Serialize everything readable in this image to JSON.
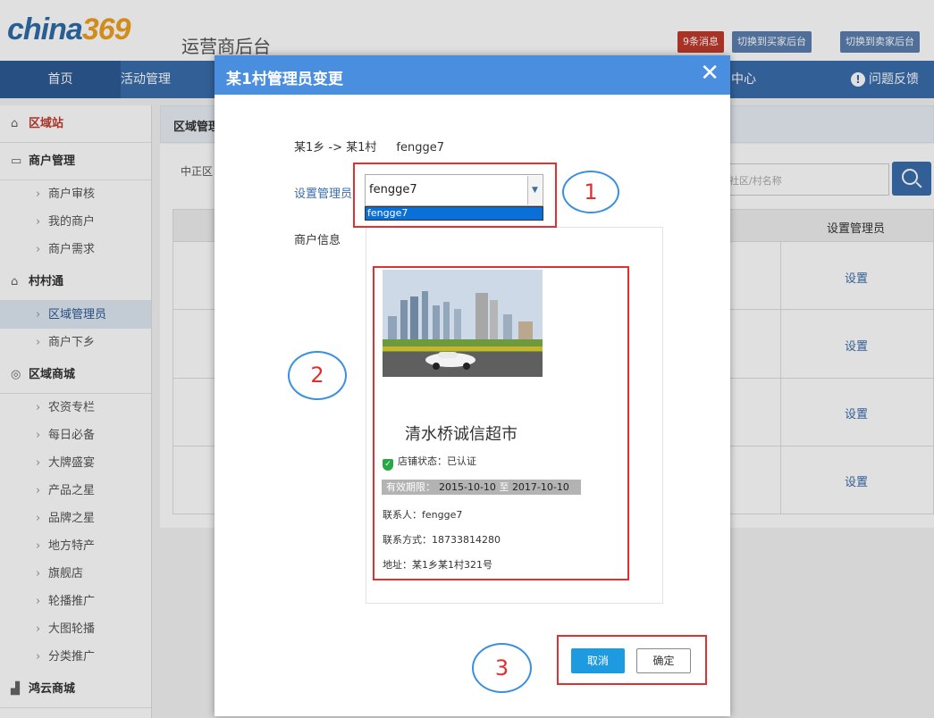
{
  "header": {
    "logo_main": "china",
    "logo_num": "369",
    "system_title": "运营商后台",
    "messages": "9条消息",
    "switch_buyer": "切换到买家后台",
    "switch_seller": "切换到卖家后台"
  },
  "nav": {
    "home": "首页",
    "activity": "活动管理",
    "center": "中心",
    "feedback": "问题反馈"
  },
  "sidebar": {
    "groups": [
      {
        "label": "区域站",
        "icon": "home-icon"
      },
      {
        "label": "商户管理",
        "icon": "shop-icon",
        "items": [
          "商户审核",
          "我的商户",
          "商户需求"
        ]
      },
      {
        "label": "村村通",
        "icon": "home-icon",
        "items": [
          "区域管理员",
          "商户下乡"
        ]
      },
      {
        "label": "区域商城",
        "icon": "mall-icon",
        "items": [
          "农资专栏",
          "每日必备",
          "大牌盛宴",
          "产品之星",
          "品牌之星",
          "地方特产",
          "旗舰店",
          "轮播推广",
          "大图轮播",
          "分类推广"
        ]
      },
      {
        "label": "鸿云商城",
        "icon": "chart-icon"
      }
    ]
  },
  "main": {
    "section_title": "区域管理",
    "filter_left": "中正区",
    "search_placeholder": "社区/村名称",
    "col_admin": "设置管理员",
    "set_link": "设置"
  },
  "modal": {
    "title": "某1村管理员变更",
    "path": "某1乡 -> 某1村",
    "current_admin": "fengge7",
    "label_set_admin": "设置管理员",
    "select_value": "fengge7",
    "option_highlighted": "fengge7",
    "label_merchant_info": "商户信息",
    "shop_name": "清水桥诚信超市",
    "status": "店铺状态：已认证",
    "validity_label": "有效期限：",
    "valid_from": "2015-10-10",
    "valid_to_word": "至",
    "valid_to": "2017-10-10",
    "contact": "联系人：fengge7",
    "phone": "联系方式：18733814280",
    "address": "地址：某1乡某1村321号",
    "cancel": "取消",
    "confirm": "确定"
  },
  "annotations": {
    "one": "1",
    "two": "2",
    "three": "3"
  },
  "colors": {
    "nav": "#3a6dab",
    "modal_head": "#4a8ee0",
    "annotation_box": "#e03030",
    "annotation_circle": "#3a8fe0",
    "primary_button": "#1e9be0"
  }
}
